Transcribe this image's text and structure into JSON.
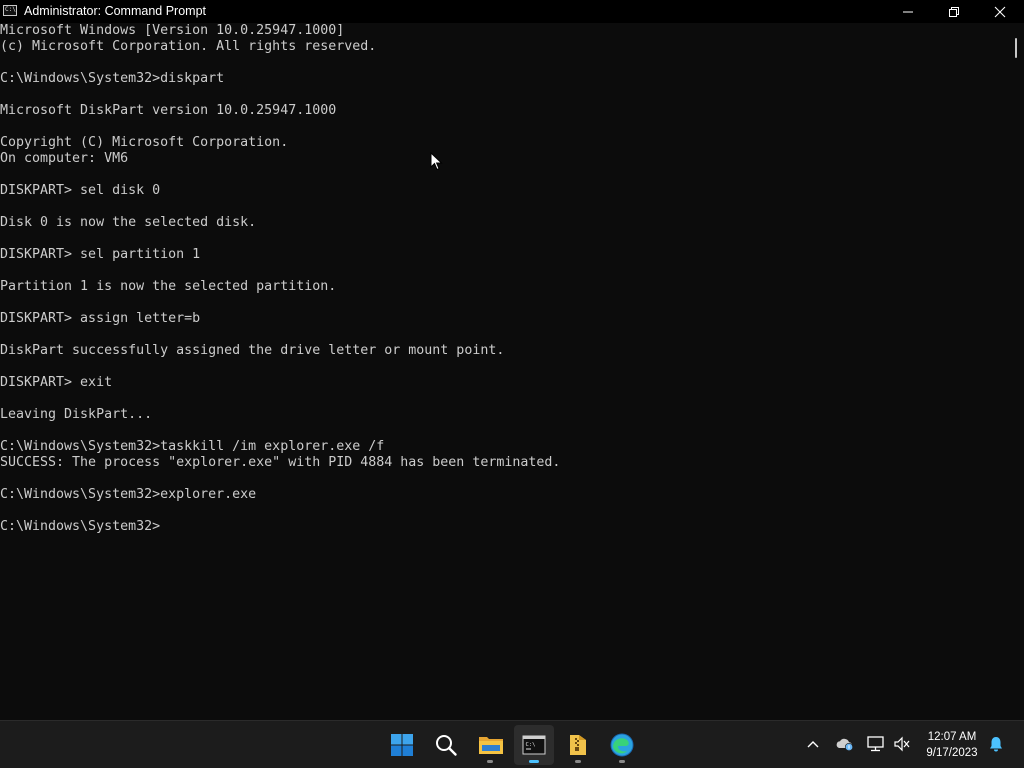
{
  "window": {
    "title": "Administrator: Command Prompt",
    "icon": "console-icon",
    "icon_glyph": "C:\\"
  },
  "console": {
    "lines": [
      "Microsoft Windows [Version 10.0.25947.1000]",
      "(c) Microsoft Corporation. All rights reserved.",
      "",
      "C:\\Windows\\System32>diskpart",
      "",
      "Microsoft DiskPart version 10.0.25947.1000",
      "",
      "Copyright (C) Microsoft Corporation.",
      "On computer: VM6",
      "",
      "DISKPART> sel disk 0",
      "",
      "Disk 0 is now the selected disk.",
      "",
      "DISKPART> sel partition 1",
      "",
      "Partition 1 is now the selected partition.",
      "",
      "DISKPART> assign letter=b",
      "",
      "DiskPart successfully assigned the drive letter or mount point.",
      "",
      "DISKPART> exit",
      "",
      "Leaving DiskPart...",
      "",
      "C:\\Windows\\System32>taskkill /im explorer.exe /f",
      "SUCCESS: The process \"explorer.exe\" with PID 4884 has been terminated.",
      "",
      "C:\\Windows\\System32>explorer.exe",
      "",
      "C:\\Windows\\System32>"
    ]
  },
  "taskbar": {
    "apps": [
      {
        "name": "start",
        "icon": "windows-logo-icon"
      },
      {
        "name": "search",
        "icon": "search-icon"
      },
      {
        "name": "file-explorer",
        "icon": "folder-icon"
      },
      {
        "name": "command-prompt",
        "icon": "terminal-icon",
        "active": true
      },
      {
        "name": "archive-folder",
        "icon": "zip-folder-icon"
      },
      {
        "name": "edge",
        "icon": "edge-browser-icon"
      }
    ],
    "tray": {
      "icons": [
        "chevron-up-icon",
        "onedrive-icon",
        "network-icon",
        "volume-muted-icon",
        "notification-bell-icon"
      ],
      "time": "12:07 AM",
      "date": "9/17/2023"
    }
  },
  "colors": {
    "console_bg": "#0c0c0c",
    "console_text": "#cccccc",
    "taskbar_bg": "#1c1c1c",
    "accent": "#4cc2ff",
    "folder_yellow": "#f5c343"
  }
}
